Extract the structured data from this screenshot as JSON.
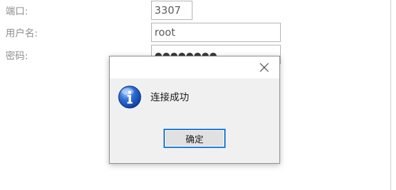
{
  "form": {
    "port_label": "端口:",
    "port_value": "3307",
    "username_label": "用户名:",
    "username_value": "root",
    "password_label": "密码:",
    "password_mask": "●●●●●●●●"
  },
  "dialog": {
    "message": "连接成功",
    "ok_label": "确定",
    "icon": "info-icon",
    "close_icon": "close-icon",
    "accent_color": "#1e7bd6"
  }
}
